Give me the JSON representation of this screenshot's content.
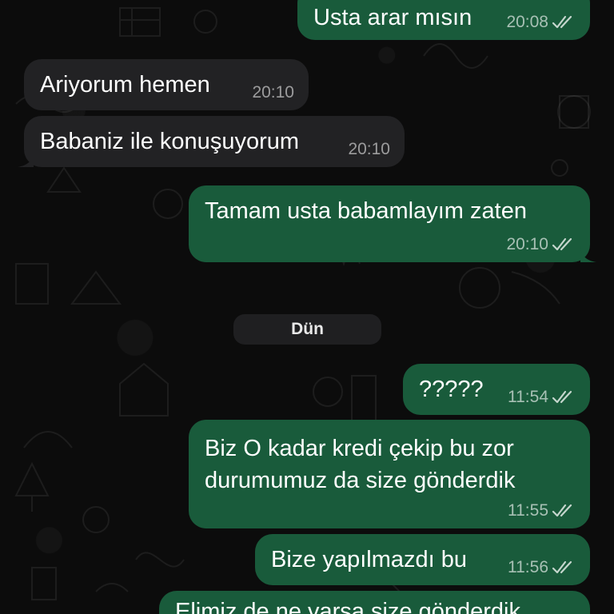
{
  "date_divider": "Dün",
  "messages": [
    {
      "direction": "out",
      "text": "Usta arar mısın",
      "time": "20:08",
      "status": "read"
    },
    {
      "direction": "in",
      "text": "Ariyorum hemen",
      "time": "20:10"
    },
    {
      "direction": "in",
      "text": "Babaniz ile konuşuyorum",
      "time": "20:10"
    },
    {
      "direction": "out",
      "text": "Tamam usta babamlayım zaten",
      "time": "20:10",
      "status": "read"
    },
    {
      "direction": "out",
      "text": "?????",
      "time": "11:54",
      "status": "read"
    },
    {
      "direction": "out",
      "text": "Biz O kadar kredi çekip bu zor\ndurumumuz da size gönderdik",
      "time": "11:55",
      "status": "read"
    },
    {
      "direction": "out",
      "text": "Bize yapılmazdı bu",
      "time": "11:56",
      "status": "read"
    },
    {
      "direction": "out",
      "text": "Elimiz de ne varsa size gönderdik",
      "time": "",
      "status": ""
    }
  ],
  "colors": {
    "outgoing_bubble": "#195b3b",
    "incoming_bubble": "#222224",
    "background": "#0c0c0c",
    "read_ticks": "#ffffff"
  },
  "icons": {
    "read_receipt": "double-check-icon"
  }
}
